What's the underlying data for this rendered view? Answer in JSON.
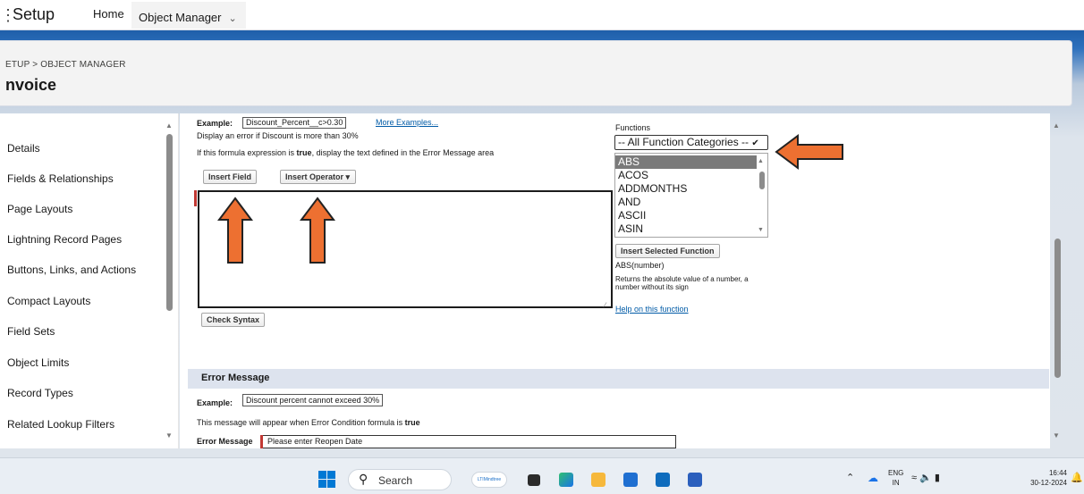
{
  "topbar": {
    "launcher_icon": "⋮",
    "app_title": "Setup",
    "tabs": [
      {
        "label": "Home"
      },
      {
        "label": "Object Manager"
      }
    ]
  },
  "header": {
    "breadcrumb": "ETUP > OBJECT MANAGER",
    "title": "nvoice"
  },
  "sidebar": {
    "items": [
      {
        "label": "Details"
      },
      {
        "label": "Fields & Relationships"
      },
      {
        "label": "Page Layouts"
      },
      {
        "label": "Lightning Record Pages"
      },
      {
        "label": "Buttons, Links, and Actions"
      },
      {
        "label": "Compact Layouts"
      },
      {
        "label": "Field Sets"
      },
      {
        "label": "Object Limits"
      },
      {
        "label": "Record Types"
      },
      {
        "label": "Related Lookup Filters"
      }
    ]
  },
  "formula": {
    "example_label": "Example:",
    "example_code": "Discount_Percent__c>0.30",
    "more_examples": "More Examples...",
    "example_desc": "Display an error if Discount is more than 30%",
    "desc_pre": "If this formula expression is ",
    "desc_bold": "true",
    "desc_post": ", display the text defined in the Error Message area",
    "insert_field": "Insert Field",
    "insert_operator": "Insert Operator",
    "check_syntax": "Check Syntax",
    "editor_value": ""
  },
  "functions": {
    "label": "Functions",
    "category_selected": "-- All Function Categories --",
    "list": [
      "ABS",
      "ACOS",
      "ADDMONTHS",
      "AND",
      "ASCII",
      "ASIN"
    ],
    "selected": "ABS",
    "insert_selected": "Insert Selected Function",
    "signature": "ABS(number)",
    "description": "Returns the absolute value of a number, a number without its sign",
    "help_link": "Help on this function"
  },
  "error_section": {
    "title": "Error Message",
    "example_label": "Example:",
    "example_value": "Discount percent cannot exceed 30%",
    "desc_pre": "This message will appear when Error Condition formula is ",
    "desc_bold": "true",
    "field_label": "Error Message",
    "field_value": "Please enter Reopen Date"
  },
  "annotation": {
    "arrow_color": "#ed7031"
  },
  "taskbar": {
    "search_label": "Search",
    "pill_text": "LTIMindtree",
    "lang_line1": "ENG",
    "lang_line2": "IN",
    "time": "16:44",
    "date": "30-12-2024"
  }
}
